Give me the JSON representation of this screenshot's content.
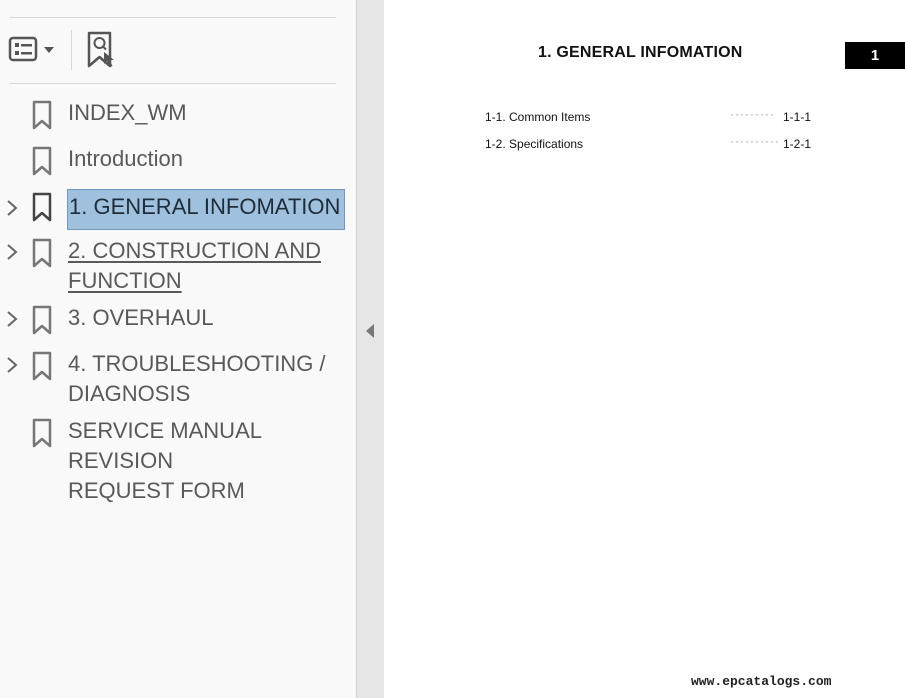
{
  "sidebar": {
    "toolbar": {
      "options_icon": "options-list-icon",
      "find_bookmark_icon": "find-current-bookmark-icon"
    },
    "bookmarks": [
      {
        "label": "INDEX_WM",
        "has_children": false,
        "selected": false,
        "underlined": false
      },
      {
        "label": "Introduction",
        "has_children": false,
        "selected": false,
        "underlined": false
      },
      {
        "label": "1. GENERAL INFOMATION",
        "has_children": true,
        "selected": true,
        "underlined": false
      },
      {
        "label": "2. CONSTRUCTION AND\nFUNCTION",
        "has_children": true,
        "selected": false,
        "underlined": true
      },
      {
        "label": "3. OVERHAUL",
        "has_children": true,
        "selected": false,
        "underlined": false
      },
      {
        "label": "4. TROUBLESHOOTING /\nDIAGNOSIS",
        "has_children": true,
        "selected": false,
        "underlined": false
      },
      {
        "label": "SERVICE MANUAL REVISION\nREQUEST FORM",
        "has_children": false,
        "selected": false,
        "underlined": false
      }
    ]
  },
  "splitter": {
    "icon": "collapse-left-arrow-icon"
  },
  "page": {
    "title": "1. GENERAL INFOMATION",
    "chapter_number": "1",
    "toc": [
      {
        "title": "1-1. Common Items",
        "dots": "·········",
        "page": "1-1-1"
      },
      {
        "title": "1-2. Specifications",
        "dots": "··········",
        "page": "1-2-1"
      }
    ],
    "watermark": "www.epcatalogs.com"
  },
  "colors": {
    "selection_bg": "#9fc1dd",
    "sidebar_bg": "#f9f9f9",
    "text_gray": "#595959",
    "chapter_box": "#000000"
  }
}
